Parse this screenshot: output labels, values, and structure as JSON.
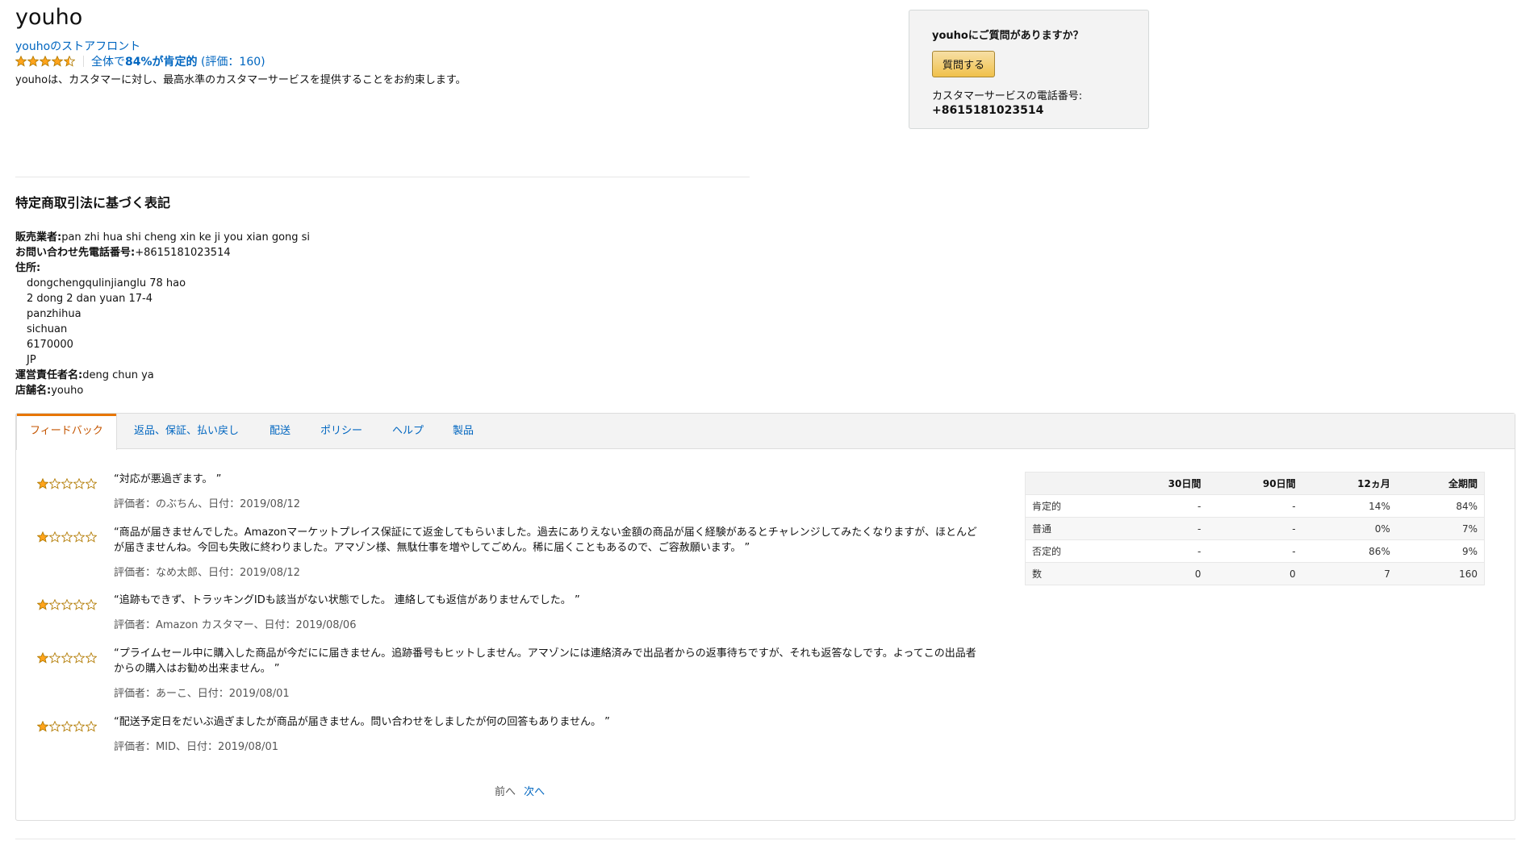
{
  "header": {
    "store_name": "youho",
    "storefront_link": "youhoのストアフロント",
    "rating_stars": 4.5,
    "rating_prefix": "全体で",
    "rating_percent": "84%が肯定的",
    "rating_count": "(評価：160)",
    "promise": "youhoは、カスタマーに対し、最高水準のカスタマーサービスを提供することをお約束します。"
  },
  "question_box": {
    "title": "youhoにご質問がありますか？",
    "button": "質問する",
    "phone_label": "カスタマーサービスの電話番号:",
    "phone": "+8615181023514"
  },
  "legal": {
    "title": "特定商取引法に基づく表記",
    "seller_label": "販売業者:",
    "seller": "pan zhi hua shi cheng xin ke ji you xian gong si",
    "phone_label": "お問い合わせ先電話番号:",
    "phone": "+8615181023514",
    "address_label": "住所:",
    "address": [
      "dongchengqulinjianglu 78 hao",
      "2 dong 2 dan yuan 17-4",
      "panzhihua",
      "sichuan",
      "6170000",
      "JP"
    ],
    "manager_label": "運営責任者名:",
    "manager": "deng chun ya",
    "shop_label": "店舗名:",
    "shop": "youho"
  },
  "tabs": [
    "フィードバック",
    "返品、保証、払い戻し",
    "配送",
    "ポリシー",
    "ヘルプ",
    "製品"
  ],
  "reviews": [
    {
      "stars": 1,
      "text": "“対応が悪過ぎます。 ”",
      "meta": "評価者：のぶちん、日付：2019/08/12"
    },
    {
      "stars": 1,
      "text": "“商品が届きませんでした。Amazonマーケットプレイス保証にて返金してもらいました。過去にありえない金額の商品が届く経験があるとチャレンジしてみたくなりますが、ほとんどが届きませんね。今回も失敗に終わりました。アマゾン様、無駄仕事を増やしてごめん。稀に届くこともあるので、ご容赦願います。 ”",
      "meta": "評価者：なめ太郎、日付：2019/08/12"
    },
    {
      "stars": 1,
      "text": "“追跡もできず、トラッキングIDも該当がない状態でした。 連絡しても返信がありませんでした。 ”",
      "meta": "評価者：Amazon カスタマー、日付：2019/08/06"
    },
    {
      "stars": 1,
      "text": "“プライムセール中に購入した商品が今だにに届きません。追跡番号もヒットしません。アマゾンには連絡済みで出品者からの返事待ちですが、それも返答なしです。よってこの出品者からの購入はお勧め出来ません。 ”",
      "meta": "評価者：あーこ、日付：2019/08/01"
    },
    {
      "stars": 1,
      "text": "“配送予定日をだいぶ過ぎましたが商品が届きません。問い合わせをしましたが何の回答もありません。 ”",
      "meta": "評価者：MID、日付：2019/08/01"
    }
  ],
  "pager": {
    "prev": "前へ",
    "next": "次へ"
  },
  "stats": {
    "headers": [
      "",
      "30日間",
      "90日間",
      "12ヵ月",
      "全期間"
    ],
    "rows": [
      {
        "label": "肯定的",
        "values": [
          "-",
          "-",
          "14%",
          "84%"
        ],
        "tone": "pos"
      },
      {
        "label": "普通",
        "values": [
          "-",
          "-",
          "0%",
          "7%"
        ],
        "tone": ""
      },
      {
        "label": "否定的",
        "values": [
          "-",
          "-",
          "86%",
          "9%"
        ],
        "tone": "neg"
      },
      {
        "label": "数",
        "values": [
          "0",
          "0",
          "7",
          "160"
        ],
        "tone": ""
      }
    ]
  },
  "colors": {
    "star_fill": "#ffa41c",
    "star_stroke": "#b27a00",
    "accent": "#e77600",
    "link": "#0066c0"
  }
}
